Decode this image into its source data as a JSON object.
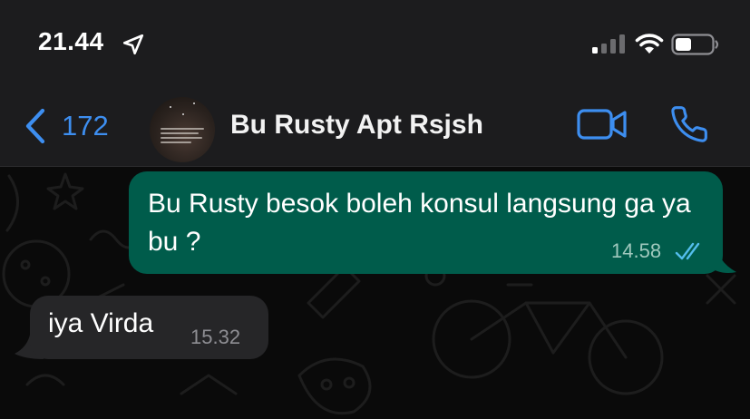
{
  "status_bar": {
    "time": "21.44",
    "icons": [
      "location-arrow-icon",
      "cellular-signal-icon",
      "wifi-icon",
      "battery-icon"
    ]
  },
  "header": {
    "back_count": "172",
    "contact_name": "Bu Rusty Apt Rsjsh",
    "icons": [
      "chevron-left-icon",
      "video-call-icon",
      "phone-call-icon"
    ]
  },
  "messages": [
    {
      "direction": "outgoing",
      "text": "Bu Rusty besok boleh konsul langsung ga ya bu ?",
      "time": "14.58",
      "status": "read"
    },
    {
      "direction": "incoming",
      "text": "iya Virda",
      "time": "15.32"
    }
  ],
  "colors": {
    "accent": "#3d8ef0",
    "outgoing_bubble": "#005c4b",
    "incoming_bubble": "#262628",
    "header_bg": "#1c1c1e",
    "chat_bg": "#0a0a0a",
    "read_tick": "#53bdeb"
  }
}
